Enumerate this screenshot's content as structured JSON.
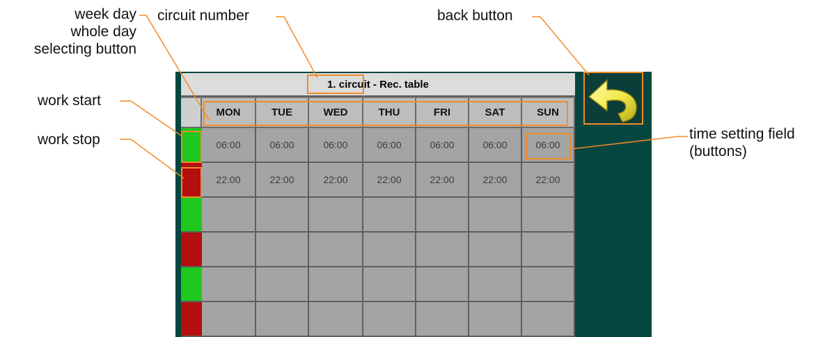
{
  "screen": {
    "title": "1. circuit - Rec. table",
    "days": [
      "MON",
      "TUE",
      "WED",
      "THU",
      "FRI",
      "SAT",
      "SUN"
    ],
    "rows": [
      {
        "type": "start",
        "times": [
          "06:00",
          "06:00",
          "06:00",
          "06:00",
          "06:00",
          "06:00",
          "06:00"
        ]
      },
      {
        "type": "stop",
        "times": [
          "22:00",
          "22:00",
          "22:00",
          "22:00",
          "22:00",
          "22:00",
          "22:00"
        ]
      },
      {
        "type": "start",
        "times": [
          "",
          "",
          "",
          "",
          "",
          "",
          ""
        ]
      },
      {
        "type": "stop",
        "times": [
          "",
          "",
          "",
          "",
          "",
          "",
          ""
        ]
      },
      {
        "type": "start",
        "times": [
          "",
          "",
          "",
          "",
          "",
          "",
          ""
        ]
      },
      {
        "type": "stop",
        "times": [
          "",
          "",
          "",
          "",
          "",
          "",
          ""
        ]
      }
    ],
    "back_icon": "back-arrow-icon"
  },
  "annotations": {
    "week_day_line1": "week day",
    "week_day_line2": "whole day",
    "week_day_line3": "selecting button",
    "circuit_number": "circuit number",
    "back_button": "back button",
    "work_start": "work start",
    "work_stop": "work stop",
    "time_setting_line1": "time setting field",
    "time_setting_line2": "(buttons)"
  },
  "colors": {
    "screen_bg": "#044640",
    "start_indicator": "#1ec81e",
    "stop_indicator": "#b40e0e",
    "highlight": "#f08c28",
    "arrow": "#f2e84a"
  }
}
